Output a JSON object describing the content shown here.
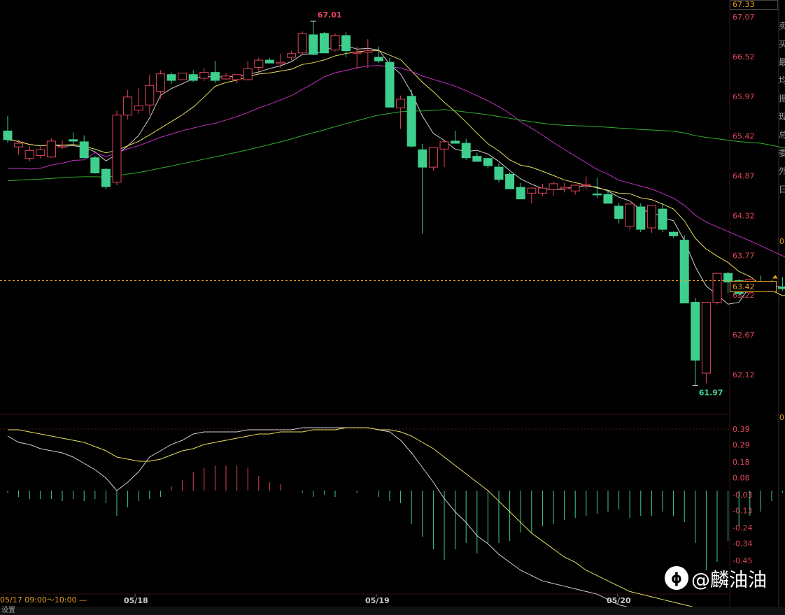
{
  "chart_data": [
    {
      "type": "candlestick",
      "price_axis_ticks": [
        67.33,
        67.07,
        66.52,
        65.97,
        65.42,
        64.87,
        64.32,
        63.77,
        63.22,
        62.67,
        62.12
      ],
      "ylim": [
        61.75,
        67.35
      ],
      "current_price": 63.42,
      "high_label": "67.01",
      "low_label": "61.97",
      "date_labels": [
        "05/18",
        "05/19",
        "05/20"
      ],
      "candles": [
        [
          65.49,
          65.7,
          65.33,
          65.37
        ],
        [
          65.27,
          65.37,
          65.16,
          65.32
        ],
        [
          65.11,
          65.28,
          65.07,
          65.22
        ],
        [
          65.15,
          65.29,
          65.11,
          65.23
        ],
        [
          65.13,
          65.39,
          65.12,
          65.35
        ],
        [
          65.27,
          65.36,
          65.24,
          65.28
        ],
        [
          65.37,
          65.47,
          65.31,
          65.35
        ],
        [
          65.34,
          65.43,
          65.23,
          65.12
        ],
        [
          65.12,
          65.15,
          64.9,
          64.91
        ],
        [
          64.96,
          64.98,
          64.68,
          64.72
        ],
        [
          64.78,
          65.77,
          64.74,
          65.71
        ],
        [
          65.71,
          66.06,
          65.65,
          65.96
        ],
        [
          65.78,
          66.09,
          65.73,
          65.84
        ],
        [
          65.85,
          66.27,
          65.72,
          66.12
        ],
        [
          66.04,
          66.33,
          65.94,
          66.28
        ],
        [
          66.27,
          66.3,
          66.14,
          66.19
        ],
        [
          66.2,
          66.29,
          66.2,
          66.29
        ],
        [
          66.27,
          66.33,
          66.17,
          66.19
        ],
        [
          66.22,
          66.36,
          66.18,
          66.3
        ],
        [
          66.3,
          66.46,
          66.15,
          66.19
        ],
        [
          66.21,
          66.29,
          66.2,
          66.25
        ],
        [
          66.2,
          66.26,
          66.15,
          66.27
        ],
        [
          66.2,
          66.46,
          66.19,
          66.35
        ],
        [
          66.37,
          66.5,
          66.29,
          66.47
        ],
        [
          66.47,
          66.5,
          66.44,
          66.43
        ],
        [
          66.42,
          66.56,
          66.36,
          66.44
        ],
        [
          66.51,
          66.6,
          66.47,
          66.56
        ],
        [
          66.57,
          66.87,
          66.55,
          66.84
        ],
        [
          66.82,
          67.01,
          66.54,
          66.55
        ],
        [
          66.84,
          66.86,
          66.59,
          66.57
        ],
        [
          66.61,
          66.84,
          66.59,
          66.81
        ],
        [
          66.81,
          66.86,
          66.51,
          66.6
        ],
        [
          66.58,
          66.66,
          66.35,
          66.58
        ],
        [
          66.58,
          66.76,
          66.36,
          66.6
        ],
        [
          66.51,
          66.66,
          66.43,
          66.46
        ],
        [
          66.44,
          66.5,
          65.82,
          65.82
        ],
        [
          65.81,
          65.98,
          65.52,
          65.93
        ],
        [
          65.97,
          66.06,
          65.26,
          65.28
        ],
        [
          65.23,
          65.31,
          64.07,
          64.99
        ],
        [
          64.99,
          65.22,
          64.94,
          65.26
        ],
        [
          65.24,
          65.36,
          64.99,
          65.34
        ],
        [
          65.35,
          65.49,
          65.32,
          65.32
        ],
        [
          65.32,
          65.38,
          65.09,
          65.12
        ],
        [
          65.14,
          65.19,
          65.08,
          65.07
        ],
        [
          65.11,
          65.12,
          64.97,
          65.01
        ],
        [
          64.99,
          65.04,
          64.78,
          64.82
        ],
        [
          64.89,
          64.92,
          64.69,
          64.69
        ],
        [
          64.71,
          64.77,
          64.55,
          64.55
        ],
        [
          64.63,
          64.7,
          64.49,
          64.7
        ],
        [
          64.63,
          64.76,
          64.59,
          64.7
        ],
        [
          64.68,
          64.79,
          64.59,
          64.76
        ],
        [
          64.69,
          64.77,
          64.64,
          64.71
        ],
        [
          64.66,
          64.75,
          64.61,
          64.74
        ],
        [
          64.75,
          64.86,
          64.68,
          64.75
        ],
        [
          64.62,
          64.84,
          64.56,
          64.61
        ],
        [
          64.61,
          64.66,
          64.52,
          64.49
        ],
        [
          64.45,
          64.5,
          64.21,
          64.28
        ],
        [
          64.17,
          64.44,
          64.12,
          64.48
        ],
        [
          64.44,
          64.49,
          64.09,
          64.13
        ],
        [
          64.15,
          64.46,
          64.08,
          64.46
        ],
        [
          64.41,
          64.49,
          64.09,
          64.13
        ],
        [
          64.09,
          64.1,
          64.01,
          64.04
        ],
        [
          63.98,
          64.05,
          63.11,
          63.11
        ],
        [
          63.12,
          63.18,
          61.97,
          62.32
        ],
        [
          62.14,
          63.12,
          62.0,
          63.12
        ],
        [
          63.12,
          63.46,
          63.09,
          63.52
        ],
        [
          63.52,
          63.54,
          63.24,
          63.4
        ],
        [
          63.42,
          63.44,
          63.2,
          63.24
        ],
        [
          63.3,
          63.45,
          63.24,
          63.44
        ],
        [
          63.37,
          63.49,
          63.32,
          63.34
        ],
        [
          63.33,
          63.43,
          63.29,
          63.32
        ],
        [
          63.33,
          63.47,
          63.28,
          63.31
        ],
        [
          63.3,
          63.48,
          63.28,
          63.34
        ],
        [
          63.3,
          63.62,
          63.29,
          63.48
        ],
        [
          63.47,
          63.55,
          63.25,
          63.4
        ]
      ]
    },
    {
      "type": "macd",
      "axis_ticks": [
        0.39,
        0.29,
        0.18,
        0.08,
        -0.03,
        -0.13,
        -0.24,
        -0.34,
        -0.45
      ],
      "ylim": [
        -0.56,
        0.4
      ],
      "histogram": [
        -0.01,
        -0.03,
        -0.04,
        -0.04,
        -0.04,
        -0.05,
        -0.04,
        -0.05,
        -0.04,
        -0.06,
        -0.12,
        -0.08,
        -0.05,
        -0.04,
        -0.03,
        0.02,
        0.05,
        0.09,
        0.11,
        0.12,
        0.12,
        0.12,
        0.11,
        0.07,
        0.04,
        0.03,
        0.0,
        -0.01,
        -0.03,
        -0.02,
        -0.03,
        0.0,
        -0.01,
        0.0,
        -0.03,
        -0.05,
        -0.06,
        -0.16,
        -0.22,
        -0.28,
        -0.33,
        -0.28,
        -0.25,
        -0.3,
        -0.25,
        -0.25,
        -0.24,
        -0.2,
        -0.2,
        -0.17,
        -0.16,
        -0.14,
        -0.13,
        -0.12,
        -0.11,
        -0.1,
        -0.09,
        -0.13,
        -0.12,
        -0.12,
        -0.1,
        -0.12,
        -0.15,
        -0.25,
        -0.38,
        -0.34,
        -0.24,
        -0.17,
        -0.12,
        -0.1,
        -0.05,
        -0.01,
        0.0,
        0.05,
        0.08,
        0.11,
        0.13
      ],
      "dif": [
        0.26,
        0.23,
        0.22,
        0.2,
        0.19,
        0.18,
        0.16,
        0.13,
        0.1,
        0.06,
        0.0,
        0.04,
        0.09,
        0.16,
        0.19,
        0.22,
        0.24,
        0.27,
        0.28,
        0.28,
        0.28,
        0.28,
        0.29,
        0.29,
        0.29,
        0.29,
        0.29,
        0.3,
        0.3,
        0.3,
        0.3,
        0.3,
        0.3,
        0.3,
        0.29,
        0.28,
        0.24,
        0.18,
        0.11,
        0.04,
        -0.03,
        -0.08,
        -0.12,
        -0.17,
        -0.2,
        -0.24,
        -0.27,
        -0.3,
        -0.32,
        -0.34,
        -0.35,
        -0.36,
        -0.37,
        -0.38,
        -0.39,
        -0.41,
        -0.43,
        -0.44,
        -0.45,
        -0.46,
        -0.47,
        -0.47,
        -0.49,
        -0.51,
        -0.54,
        -0.55,
        -0.54,
        -0.53,
        -0.52,
        -0.51,
        -0.5,
        -0.5,
        -0.49,
        -0.48,
        -0.47,
        -0.45,
        -0.43
      ],
      "dea": [
        0.29,
        0.29,
        0.28,
        0.27,
        0.26,
        0.25,
        0.24,
        0.23,
        0.21,
        0.19,
        0.16,
        0.15,
        0.14,
        0.14,
        0.15,
        0.17,
        0.19,
        0.2,
        0.22,
        0.23,
        0.24,
        0.25,
        0.26,
        0.27,
        0.27,
        0.28,
        0.28,
        0.28,
        0.29,
        0.29,
        0.29,
        0.3,
        0.3,
        0.3,
        0.29,
        0.29,
        0.28,
        0.26,
        0.23,
        0.2,
        0.16,
        0.12,
        0.08,
        0.04,
        0.0,
        -0.04,
        -0.08,
        -0.12,
        -0.16,
        -0.19,
        -0.22,
        -0.25,
        -0.27,
        -0.3,
        -0.32,
        -0.34,
        -0.36,
        -0.38,
        -0.39,
        -0.4,
        -0.41,
        -0.42,
        -0.43,
        -0.44,
        -0.45,
        -0.46,
        -0.47,
        -0.48,
        -0.48,
        -0.49,
        -0.49,
        -0.49,
        -0.49,
        -0.49,
        -0.48,
        -0.48,
        -0.47
      ]
    }
  ],
  "ui": {
    "top_price_box": "67.33",
    "current_price_box": "63.42",
    "time_label": "05/17 09:00～10:00 —",
    "settings_label": "设置",
    "zero_marker_top": "0",
    "zero_marker_bottom": "0",
    "side_chars": "卖买最均振现总委外日",
    "watermark_text": "@麟油油"
  },
  "colors": {
    "up": "#e0455a",
    "down": "#3ecf8e",
    "ma_white": "#d0d0d0",
    "ma_yellow": "#e8e060",
    "ma_magenta": "#c030c0",
    "ma_green": "#30b030",
    "price_text": "#e0455a",
    "grid": "#2a0a0a",
    "current_line": "#e0a020"
  }
}
